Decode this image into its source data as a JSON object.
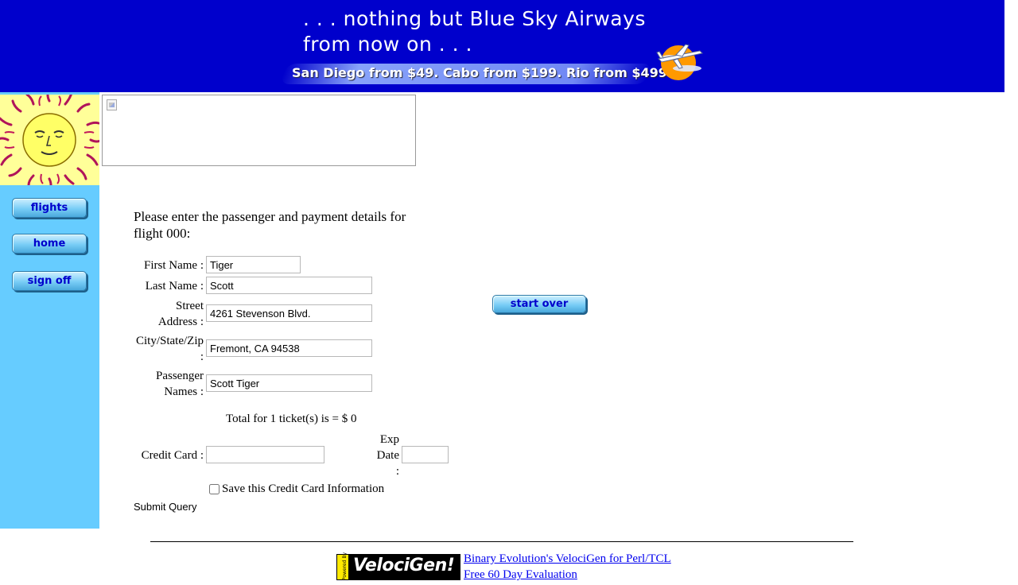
{
  "banner": {
    "line1": ". . . nothing but Blue Sky Airways",
    "line2": "from now on . . .",
    "promo": "San Diego from $49. Cabo from $199. Rio from $499.",
    "logo_icon": "plane-sun-icon"
  },
  "sidebar": {
    "logo_icon": "sun-face-icon",
    "items": [
      {
        "label": "flights"
      },
      {
        "label": "home"
      },
      {
        "label": "sign off"
      }
    ]
  },
  "form": {
    "intro": "Please enter the passenger and payment details for flight 000:",
    "first_name": {
      "label": "First Name :",
      "value": "Tiger"
    },
    "last_name": {
      "label": "Last Name :",
      "value": "Scott"
    },
    "street_address": {
      "label_line1": "Street",
      "label_line2": "Address :",
      "value": "4261 Stevenson Blvd."
    },
    "city_state_zip": {
      "label_line1": "City/State/Zip",
      "label_line2": ":",
      "value": "Fremont, CA 94538"
    },
    "passenger_names": {
      "label_line1": "Passenger",
      "label_line2": "Names :",
      "value": "Scott Tiger"
    },
    "total": "Total for 1 ticket(s) is = $ 0",
    "credit_card": {
      "label": "Credit Card :",
      "value": ""
    },
    "exp_date": {
      "label_line1": "Exp",
      "label_line2": "Date",
      "label_line3": ":",
      "value": ""
    },
    "save_card": {
      "label": "Save this Credit Card Information",
      "checked": false
    },
    "submit_label": "Submit Query",
    "start_over_label": "start over"
  },
  "footer": {
    "logo_text": "VelociGen!",
    "logo_powered": "Powered By",
    "link1": "Binary Evolution's VelociGen for Perl/TCL",
    "link2": "Free 60 Day Evaluation"
  },
  "colors": {
    "banner_bg": "#0000cc",
    "sidebar_bg": "#66ccff",
    "link": "#0000ee"
  }
}
